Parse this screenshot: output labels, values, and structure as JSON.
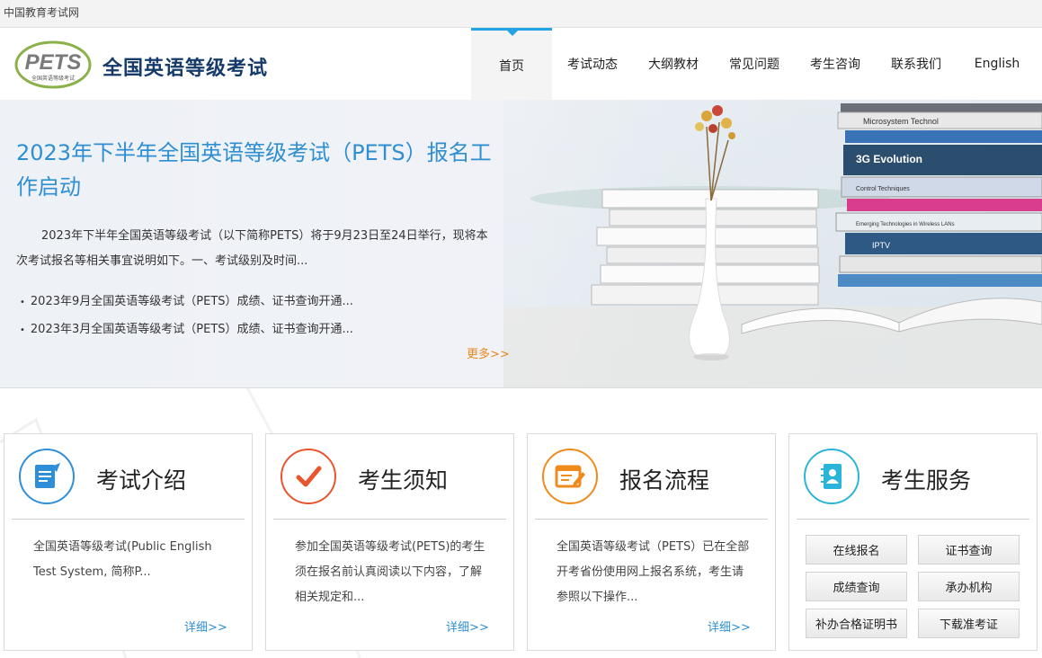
{
  "topbar": {
    "site_name": "中国教育考试网"
  },
  "header": {
    "logo_text": "PETS",
    "logo_subtext": "全国英语等级考试",
    "title": "全国英语等级考试",
    "nav": [
      "首页",
      "考试动态",
      "大纲教材",
      "常见问题",
      "考生咨询",
      "联系我们",
      "English"
    ]
  },
  "banner": {
    "headline": "2023年下半年全国英语等级考试（PETS）报名工作启动",
    "summary": "2023年下半年全国英语等级考试（以下简称PETS）将于9月23日至24日举行，现将本次考试报名等相关事宜说明如下。一、考试级别及时间...",
    "news": [
      "2023年9月全国英语等级考试（PETS）成绩、证书查询开通...",
      "2023年3月全国英语等级考试（PETS）成绩、证书查询开通..."
    ],
    "more": "更多>>",
    "book_titles": [
      "Microsystem Technol",
      "3G Evolution",
      "Control Techniques",
      "Emerging Technologies in Wireless LANs",
      "IPTV"
    ]
  },
  "cards": [
    {
      "title": "考试介绍",
      "text": "全国英语等级考试(Public English Test System, 简称P...",
      "detail": "详细>>",
      "color": "#2e8fd8"
    },
    {
      "title": "考生须知",
      "text": "参加全国英语等级考试(PETS)的考生须在报名前认真阅读以下内容，了解相关规定和...",
      "detail": "详细>>",
      "color": "#e8552f"
    },
    {
      "title": "报名流程",
      "text": "全国英语等级考试（PETS）已在全部开考省份使用网上报名系统，考生请参照以下操作...",
      "detail": "详细>>",
      "color": "#ef8a1d"
    }
  ],
  "service": {
    "title": "考生服务",
    "color": "#2bb4d9",
    "buttons": [
      "在线报名",
      "证书查询",
      "成绩查询",
      "承办机构",
      "补办合格证明书",
      "下载准考证"
    ]
  }
}
